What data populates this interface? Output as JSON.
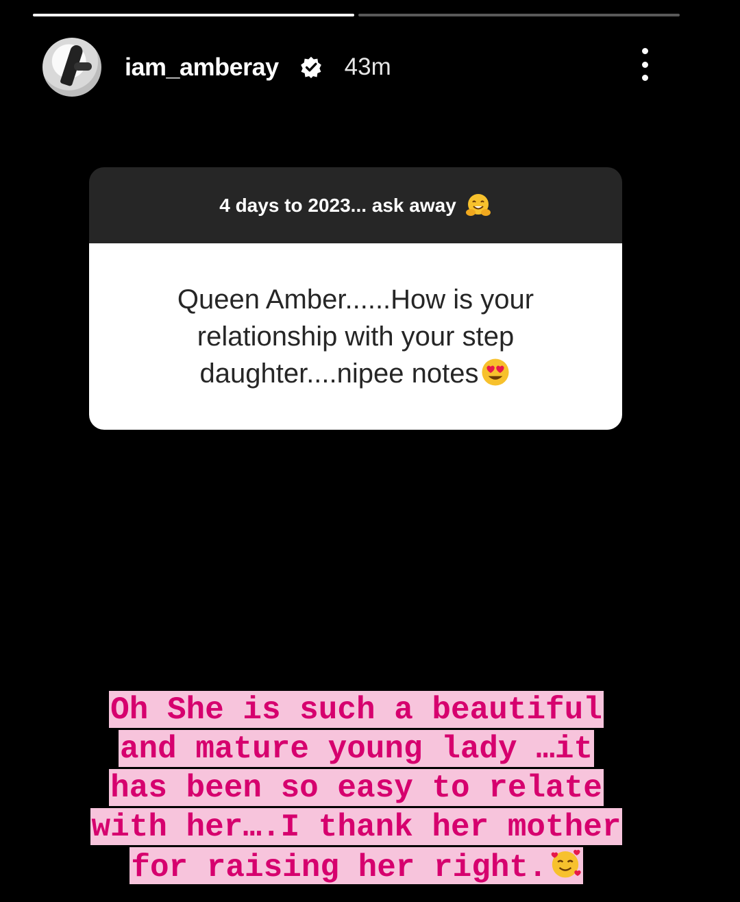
{
  "story": {
    "segments_total": 2,
    "segments_done": 1
  },
  "header": {
    "username": "iam_amberay",
    "verified_icon": "verified-badge-icon",
    "time": "43m",
    "more_icon": "more-options-icon"
  },
  "question_card": {
    "prompt": "4 days to 2023... ask away",
    "prompt_emoji": "hugging-face-emoji",
    "question": "Queen Amber......How is your\nrelationship with your step\ndaughter....nipee notes",
    "question_emoji": "heart-eyes-emoji",
    "colors": {
      "header_bg": "#262626",
      "body_bg": "#ffffff",
      "body_text": "#262626"
    }
  },
  "answer": {
    "lines": [
      "Oh She is such a beautiful",
      "and mature young lady …it",
      "has been so easy to relate",
      "with her….I thank her mother",
      "for raising her right."
    ],
    "end_emoji": "smiling-face-with-hearts-emoji",
    "colors": {
      "text": "#d6006e",
      "highlight": "#f7c4dc"
    }
  }
}
